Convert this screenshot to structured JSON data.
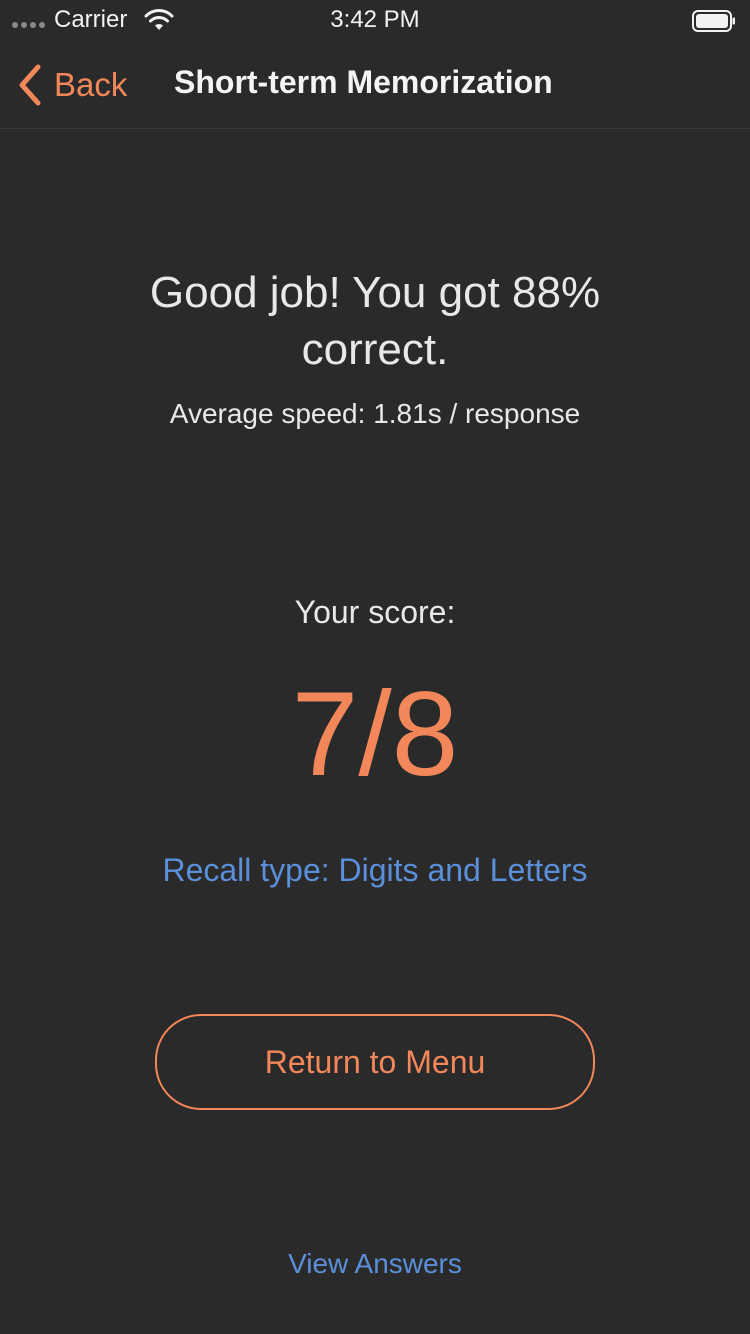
{
  "status_bar": {
    "carrier": "Carrier",
    "time": "3:42 PM",
    "icons": [
      "signal-dots-icon",
      "wifi-icon",
      "battery-icon"
    ]
  },
  "nav": {
    "back_label": "Back",
    "title": "Short-term Memorization",
    "back_icon": "chevron-left-icon"
  },
  "result": {
    "headline": "Good job! You got 88% correct.",
    "average_speed": "Average speed: 1.81s / response",
    "score_label": "Your score:",
    "score": "7/8",
    "recall_type": "Recall type: Digits and Letters"
  },
  "actions": {
    "return_label": "Return to Menu",
    "view_answers_label": "View Answers"
  },
  "colors": {
    "background": "#2a2a2a",
    "accent": "#f2875a",
    "link": "#5b8fd9",
    "text": "#e8e8e8"
  }
}
